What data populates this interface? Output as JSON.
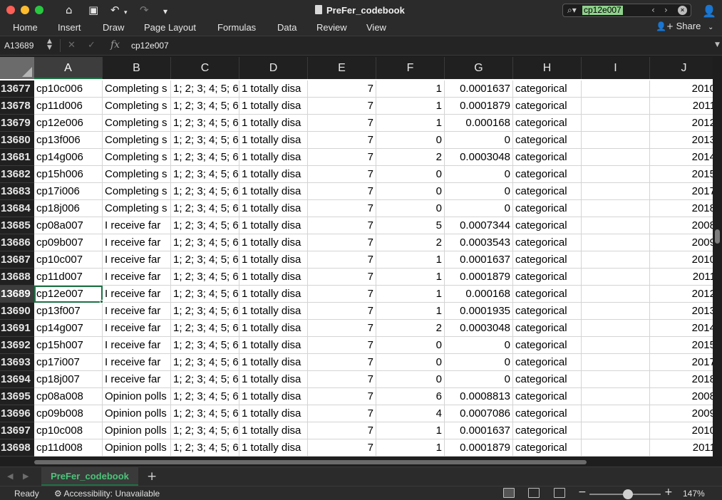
{
  "window": {
    "title": "PreFer_codebook",
    "search": {
      "value": "cp12e007"
    }
  },
  "quick_access": {
    "icons": [
      "home-icon",
      "save-icon",
      "undo-icon",
      "redo-icon",
      "customize-icon"
    ]
  },
  "ribbon": {
    "tabs": [
      "Home",
      "Insert",
      "Draw",
      "Page Layout",
      "Formulas",
      "Data",
      "Review",
      "View"
    ],
    "share_label": "Share"
  },
  "formula_bar": {
    "name_box": "A13689",
    "fx": "fx",
    "value": "cp12e007"
  },
  "sheet": {
    "columns": [
      "A",
      "B",
      "C",
      "D",
      "E",
      "F",
      "G",
      "H",
      "I",
      "J"
    ],
    "active_column": "A",
    "active_row": "13689",
    "rows": [
      {
        "num": "13677",
        "cells": [
          "cp10c006",
          "Completing s",
          "1; 2; 3; 4; 5; 6",
          "1 totally disa",
          "7",
          "1",
          "0.0001637",
          "categorical",
          "",
          "2010"
        ]
      },
      {
        "num": "13678",
        "cells": [
          "cp11d006",
          "Completing s",
          "1; 2; 3; 4; 5; 6",
          "1 totally disa",
          "7",
          "1",
          "0.0001879",
          "categorical",
          "",
          "2011"
        ]
      },
      {
        "num": "13679",
        "cells": [
          "cp12e006",
          "Completing s",
          "1; 2; 3; 4; 5; 6",
          "1 totally disa",
          "7",
          "1",
          "0.000168",
          "categorical",
          "",
          "2012"
        ]
      },
      {
        "num": "13680",
        "cells": [
          "cp13f006",
          "Completing s",
          "1; 2; 3; 4; 5; 6",
          "1 totally disa",
          "7",
          "0",
          "0",
          "categorical",
          "",
          "2013"
        ]
      },
      {
        "num": "13681",
        "cells": [
          "cp14g006",
          "Completing s",
          "1; 2; 3; 4; 5; 6",
          "1 totally disa",
          "7",
          "2",
          "0.0003048",
          "categorical",
          "",
          "2014"
        ]
      },
      {
        "num": "13682",
        "cells": [
          "cp15h006",
          "Completing s",
          "1; 2; 3; 4; 5; 6",
          "1 totally disa",
          "7",
          "0",
          "0",
          "categorical",
          "",
          "2015"
        ]
      },
      {
        "num": "13683",
        "cells": [
          "cp17i006",
          "Completing s",
          "1; 2; 3; 4; 5; 6",
          "1 totally disa",
          "7",
          "0",
          "0",
          "categorical",
          "",
          "2017"
        ]
      },
      {
        "num": "13684",
        "cells": [
          "cp18j006",
          "Completing s",
          "1; 2; 3; 4; 5; 6",
          "1 totally disa",
          "7",
          "0",
          "0",
          "categorical",
          "",
          "2018"
        ]
      },
      {
        "num": "13685",
        "cells": [
          "cp08a007",
          "I receive far",
          "1; 2; 3; 4; 5; 6",
          "1 totally disa",
          "7",
          "5",
          "0.0007344",
          "categorical",
          "",
          "2008"
        ]
      },
      {
        "num": "13686",
        "cells": [
          "cp09b007",
          "I receive far",
          "1; 2; 3; 4; 5; 6",
          "1 totally disa",
          "7",
          "2",
          "0.0003543",
          "categorical",
          "",
          "2009"
        ]
      },
      {
        "num": "13687",
        "cells": [
          "cp10c007",
          "I receive far",
          "1; 2; 3; 4; 5; 6",
          "1 totally disa",
          "7",
          "1",
          "0.0001637",
          "categorical",
          "",
          "2010"
        ]
      },
      {
        "num": "13688",
        "cells": [
          "cp11d007",
          "I receive far",
          "1; 2; 3; 4; 5; 6",
          "1 totally disa",
          "7",
          "1",
          "0.0001879",
          "categorical",
          "",
          "2011"
        ]
      },
      {
        "num": "13689",
        "cells": [
          "cp12e007",
          "I receive far",
          "1; 2; 3; 4; 5; 6",
          "1 totally disa",
          "7",
          "1",
          "0.000168",
          "categorical",
          "",
          "2012"
        ]
      },
      {
        "num": "13690",
        "cells": [
          "cp13f007",
          "I receive far",
          "1; 2; 3; 4; 5; 6",
          "1 totally disa",
          "7",
          "1",
          "0.0001935",
          "categorical",
          "",
          "2013"
        ]
      },
      {
        "num": "13691",
        "cells": [
          "cp14g007",
          "I receive far",
          "1; 2; 3; 4; 5; 6",
          "1 totally disa",
          "7",
          "2",
          "0.0003048",
          "categorical",
          "",
          "2014"
        ]
      },
      {
        "num": "13692",
        "cells": [
          "cp15h007",
          "I receive far",
          "1; 2; 3; 4; 5; 6",
          "1 totally disa",
          "7",
          "0",
          "0",
          "categorical",
          "",
          "2015"
        ]
      },
      {
        "num": "13693",
        "cells": [
          "cp17i007",
          "I receive far",
          "1; 2; 3; 4; 5; 6",
          "1 totally disa",
          "7",
          "0",
          "0",
          "categorical",
          "",
          "2017"
        ]
      },
      {
        "num": "13694",
        "cells": [
          "cp18j007",
          "I receive far",
          "1; 2; 3; 4; 5; 6",
          "1 totally disa",
          "7",
          "0",
          "0",
          "categorical",
          "",
          "2018"
        ]
      },
      {
        "num": "13695",
        "cells": [
          "cp08a008",
          "Opinion polls",
          "1; 2; 3; 4; 5; 6",
          "1 totally disa",
          "7",
          "6",
          "0.0008813",
          "categorical",
          "",
          "2008"
        ]
      },
      {
        "num": "13696",
        "cells": [
          "cp09b008",
          "Opinion polls",
          "1; 2; 3; 4; 5; 6",
          "1 totally disa",
          "7",
          "4",
          "0.0007086",
          "categorical",
          "",
          "2009"
        ]
      },
      {
        "num": "13697",
        "cells": [
          "cp10c008",
          "Opinion polls",
          "1; 2; 3; 4; 5; 6",
          "1 totally disa",
          "7",
          "1",
          "0.0001637",
          "categorical",
          "",
          "2010"
        ]
      },
      {
        "num": "13698",
        "cells": [
          "cp11d008",
          "Opinion polls",
          "1; 2; 3; 4; 5; 6",
          "1 totally disa",
          "7",
          "1",
          "0.0001879",
          "categorical",
          "",
          "2011"
        ]
      }
    ]
  },
  "sheet_tabs": {
    "tabs": [
      "PreFer_codebook"
    ],
    "active": "PreFer_codebook",
    "add_label": "+"
  },
  "status_bar": {
    "ready": "Ready",
    "accessibility": "Accessibility: Unavailable",
    "zoom": "147%"
  },
  "colors": {
    "accent": "#1e7145",
    "sheet_tab_text": "#4cc47a",
    "search_highlight": "#8fd18c"
  }
}
